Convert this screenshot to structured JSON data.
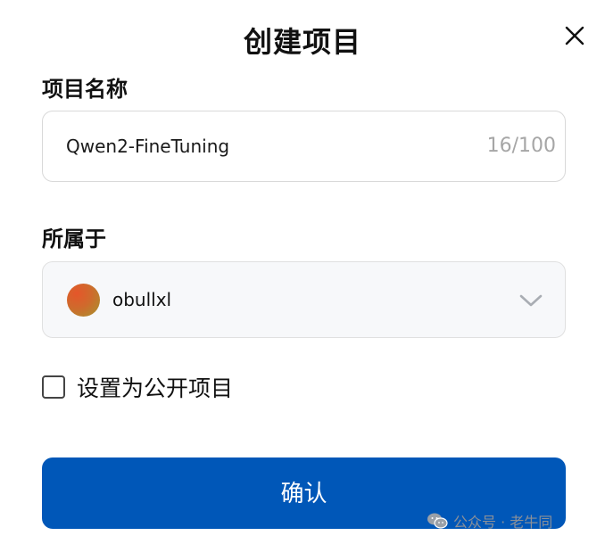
{
  "dialog": {
    "title": "创建项目",
    "close_icon": "close-icon"
  },
  "project_name": {
    "label": "项目名称",
    "value": "Qwen2-FineTuning",
    "counter": "16/100"
  },
  "owner": {
    "label": "所属于",
    "selected": "obullxl",
    "avatar_icon": "avatar",
    "dropdown_icon": "chevron-down-icon"
  },
  "public_option": {
    "label": "设置为公开项目",
    "checked": false
  },
  "confirm": {
    "label": "确认"
  },
  "watermark": {
    "text": "公众号 · 老牛同",
    "icon": "wechat-icon"
  },
  "colors": {
    "primary": "#0057b8",
    "border": "#d9d9d9",
    "select_bg": "#f7f8fa",
    "muted_text": "#a6a6a6"
  }
}
